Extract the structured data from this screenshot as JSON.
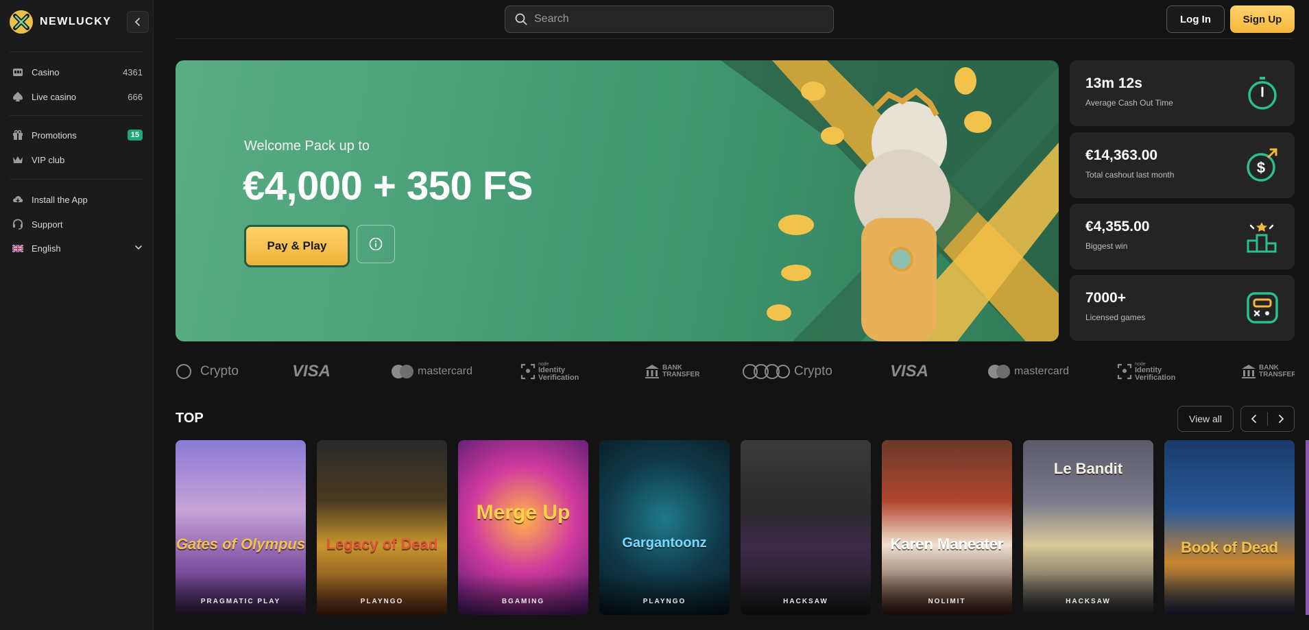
{
  "brand": {
    "name": "NEWLUCKY"
  },
  "sidebar": {
    "items": [
      {
        "label": "Casino",
        "count": "4361",
        "icon": "casino-icon"
      },
      {
        "label": "Live casino",
        "count": "666",
        "icon": "spade-icon"
      },
      {
        "label": "Promotions",
        "badge": "15",
        "icon": "gift-icon"
      },
      {
        "label": "VIP club",
        "icon": "crown-icon"
      },
      {
        "label": "Install the App",
        "icon": "cloud-download-icon"
      },
      {
        "label": "Support",
        "icon": "headset-icon"
      },
      {
        "label": "English",
        "icon": "uk-flag-icon"
      }
    ]
  },
  "header": {
    "search_placeholder": "Search",
    "login_label": "Log In",
    "signup_label": "Sign Up"
  },
  "hero": {
    "kicker": "Welcome Pack up to",
    "title": "€4,000 + 350 FS",
    "play_label": "Pay & Play"
  },
  "stats": [
    {
      "value": "13m 12s",
      "label": "Average Cash Out Time",
      "icon": "stopwatch-icon"
    },
    {
      "value": "€14,363.00",
      "label": "Total cashout last month",
      "icon": "dollar-coin-icon"
    },
    {
      "value": "€4,355.00",
      "label": "Biggest win",
      "icon": "podium-icon"
    },
    {
      "value": "7000+",
      "label": "Licensed games",
      "icon": "slot-machine-icon"
    }
  ],
  "payments": {
    "crypto": "Crypto",
    "visa": "VISA",
    "mastercard": "mastercard",
    "identity_small": "node",
    "identity_line1": "Identity",
    "identity_line2": "Verification",
    "bank_line1": "BANK",
    "bank_line2": "TRANSFER"
  },
  "top": {
    "title": "TOP",
    "view_all": "View all",
    "games": [
      {
        "name": "Gates of Olympus",
        "provider": "PRAGMATIC PLAY"
      },
      {
        "name": "Legacy of Dead",
        "provider": "PLAYNGO"
      },
      {
        "name": "Merge Up",
        "provider": "BGAMING"
      },
      {
        "name": "Gargantoonz",
        "provider": "PLAYNGO"
      },
      {
        "name": "",
        "provider": "HACKSAW"
      },
      {
        "name": "Karen Maneater",
        "provider": "NOLIMIT"
      },
      {
        "name": "Le Bandit",
        "provider": "HACKSAW"
      },
      {
        "name": "Book of Dead",
        "provider": ""
      }
    ]
  },
  "colors": {
    "accent": "#f5b73c",
    "hero_green": "#4ea37b",
    "badge_green": "#1fa77a",
    "icon_green": "#2bbf8f"
  }
}
